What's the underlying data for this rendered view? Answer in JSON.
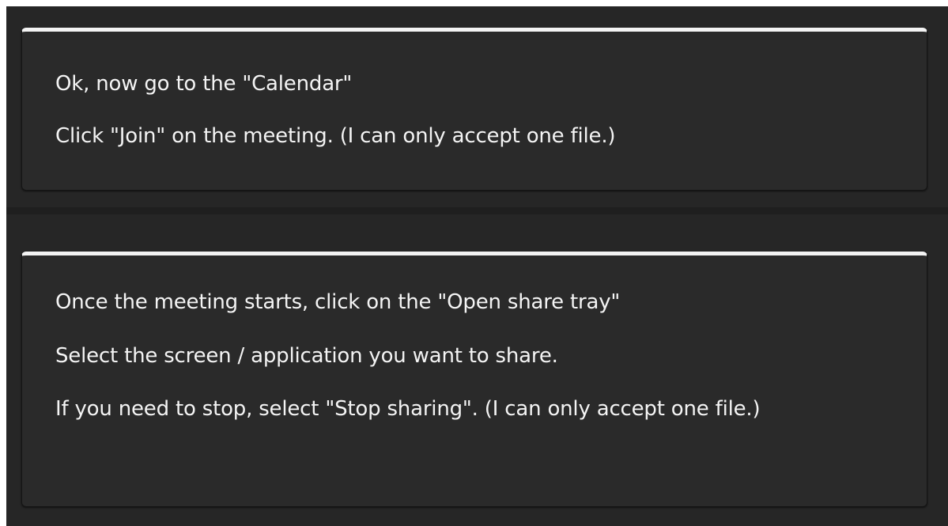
{
  "messages": [
    {
      "lines": [
        "Ok, now go to the \"Calendar\"",
        "Click \"Join\" on the meeting. (I can only accept one file.)"
      ]
    },
    {
      "lines": [
        "Once the meeting starts, click on the \"Open share tray\"",
        "Select the screen / application you want to share.",
        "If you need to stop, select \"Stop sharing\". (I can only accept one file.)"
      ]
    }
  ]
}
